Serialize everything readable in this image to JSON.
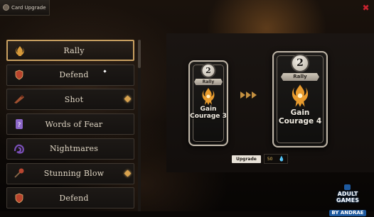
{
  "window": {
    "title": "Card Upgrade",
    "close_icon": "close-x-icon",
    "accent": "#c8232f"
  },
  "card_list": {
    "items": [
      {
        "label": "Rally",
        "icon": "rally-icon",
        "icon_color": "#d89a3a",
        "selected": true,
        "upgradable": false
      },
      {
        "label": "Defend",
        "icon": "shield-icon",
        "icon_color": "#b8432c",
        "selected": false,
        "upgradable": false
      },
      {
        "label": "Shot",
        "icon": "gun-icon",
        "icon_color": "#a05030",
        "selected": false,
        "upgradable": true
      },
      {
        "label": "Words of Fear",
        "icon": "scroll-icon",
        "icon_color": "#8c66c8",
        "selected": false,
        "upgradable": false
      },
      {
        "label": "Nightmares",
        "icon": "nightmare-icon",
        "icon_color": "#7a4fb8",
        "selected": false,
        "upgradable": false
      },
      {
        "label": "Stunning Blow",
        "icon": "mace-icon",
        "icon_color": "#b84630",
        "selected": false,
        "upgradable": true
      },
      {
        "label": "Defend",
        "icon": "shield-icon",
        "icon_color": "#b8432c",
        "selected": false,
        "upgradable": false
      }
    ],
    "upgrade_gem_color": "#d8a24e"
  },
  "preview": {
    "current": {
      "cost": "2",
      "banner": "Rally",
      "desc_line1": "Gain",
      "desc_line2": "Courage",
      "value": "3"
    },
    "upgraded": {
      "cost": "2",
      "banner": "Rally",
      "desc_line1": "Gain",
      "desc_line2": "Courage",
      "value": "4"
    },
    "arrow_icon": "triple-arrow-icon",
    "art_icon": "flame-figure-icon"
  },
  "upgrade": {
    "button_label": "Upgrade",
    "cost": "50",
    "currency_icon": "flame-icon"
  },
  "watermark": {
    "line1": "ADULT GAMES",
    "line2": "BY ANDRAE"
  }
}
